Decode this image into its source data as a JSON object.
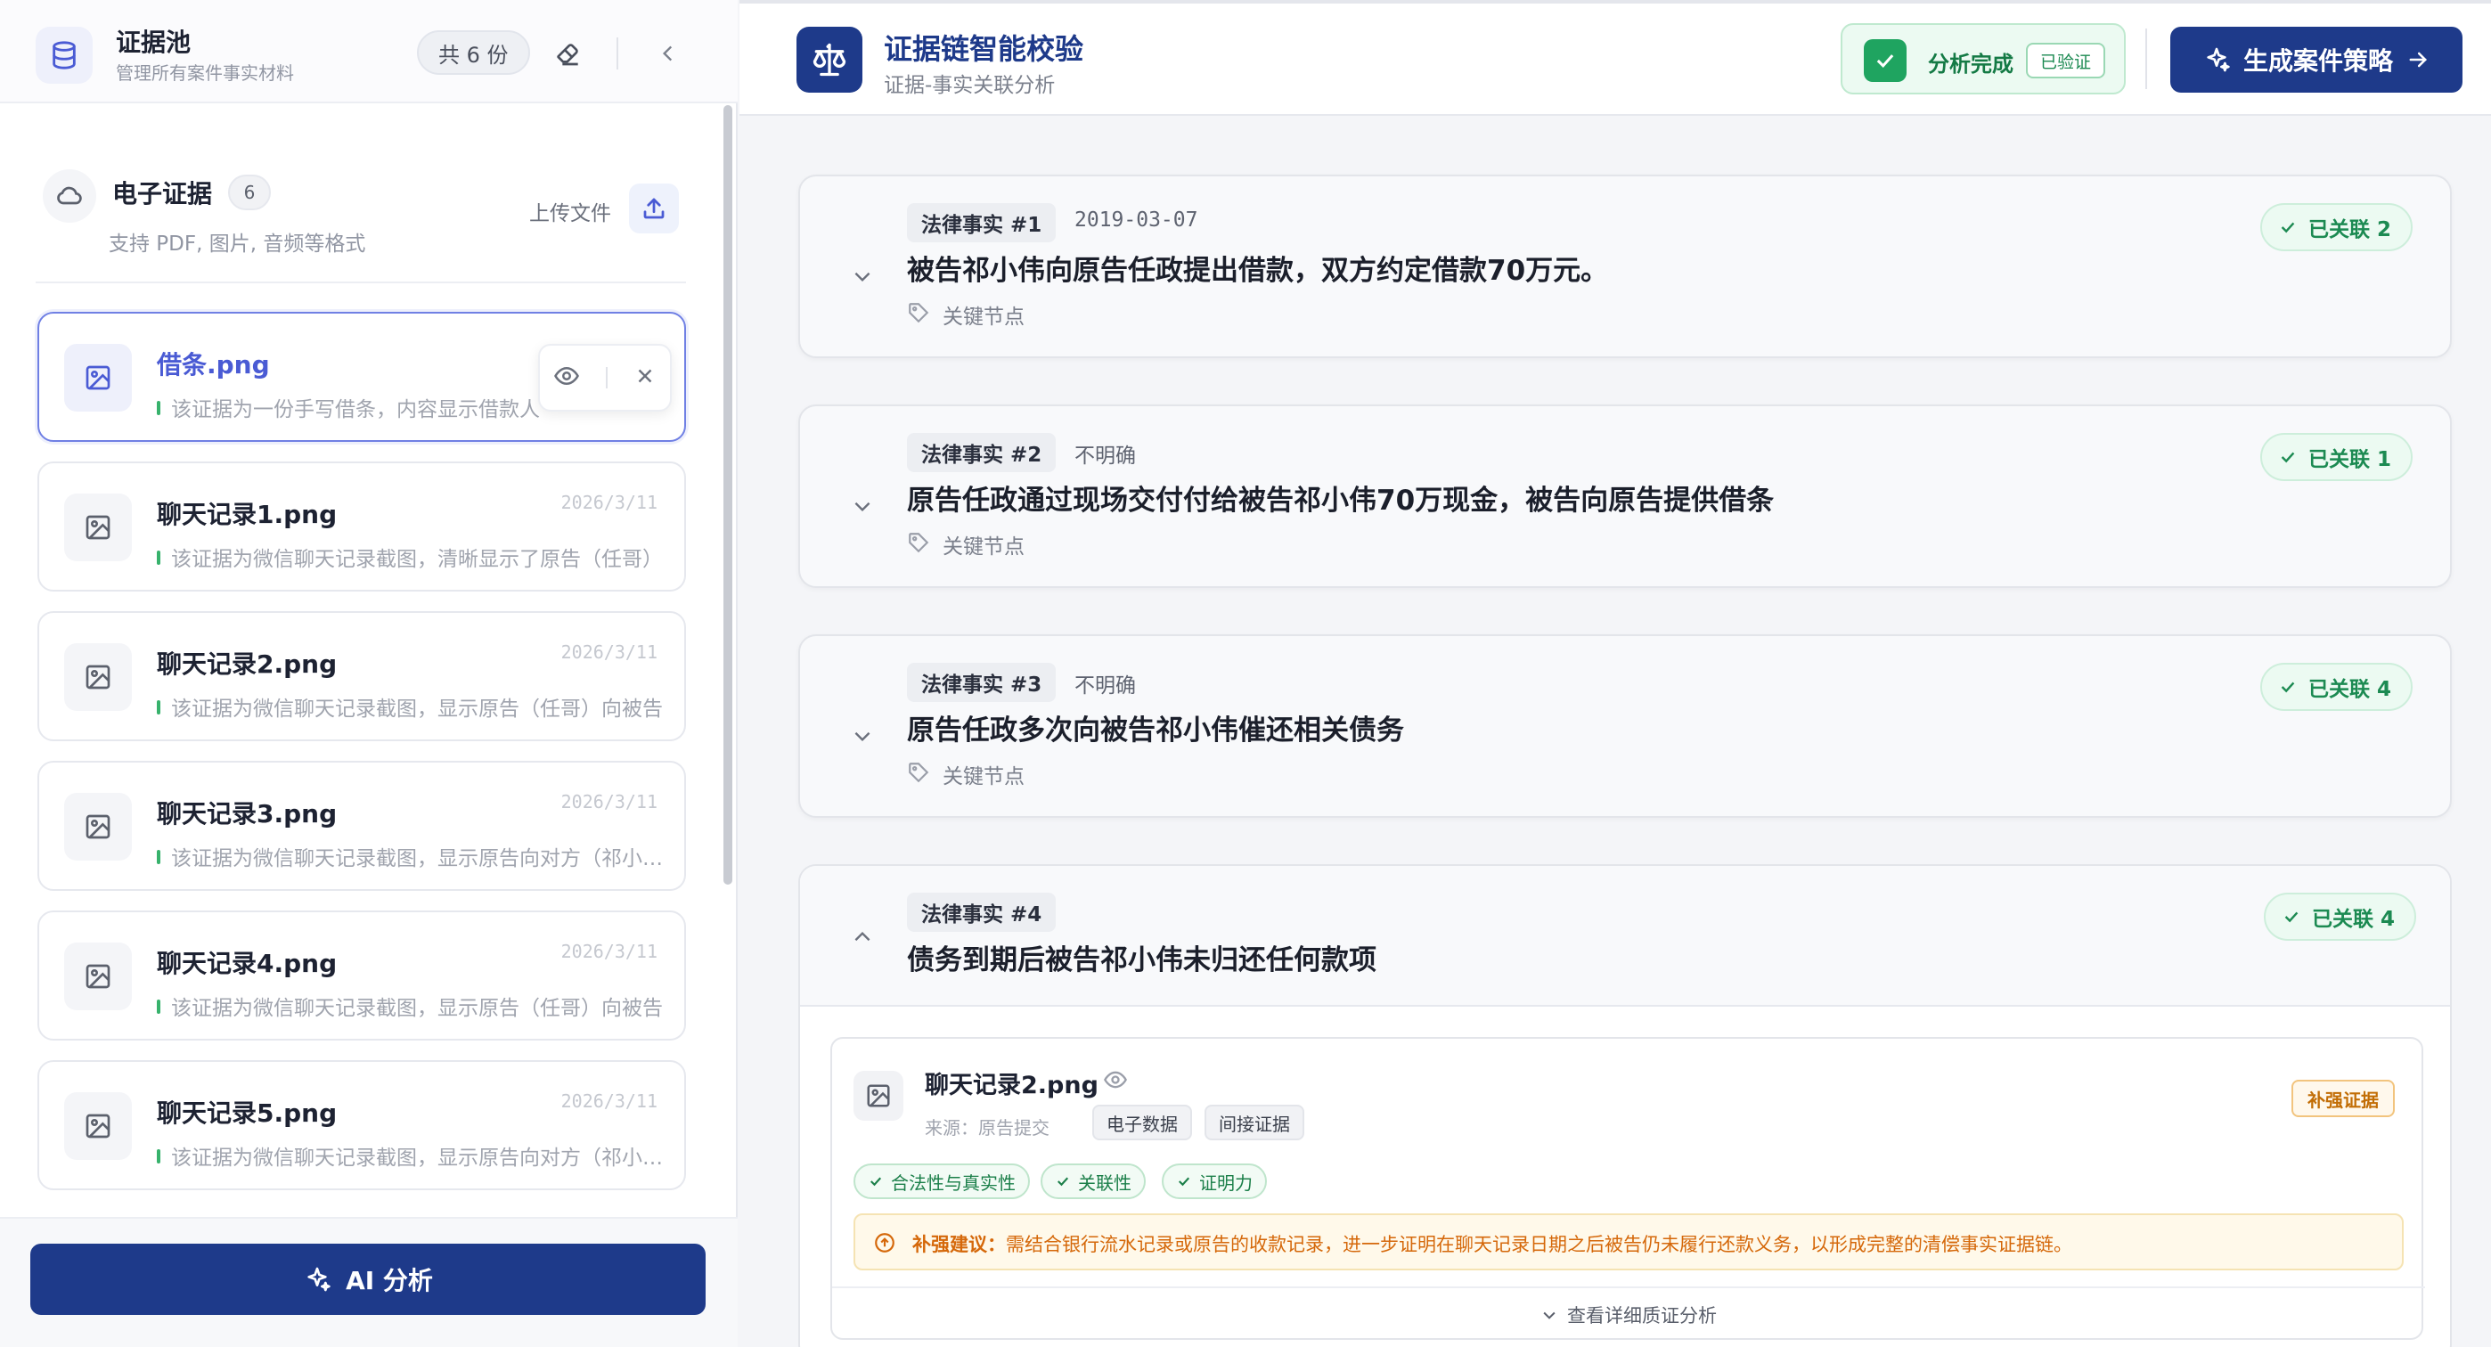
{
  "left_panel": {
    "title": "证据池",
    "subtitle": "管理所有案件事实材料",
    "count_label": "共 6 份",
    "section": {
      "title": "电子证据",
      "count": "6",
      "subtitle": "支持 PDF, 图片, 音频等格式",
      "upload_label": "上传文件"
    },
    "evidence": [
      {
        "name": "借条.png",
        "date": "",
        "desc": "该证据为一份手写借条，内容显示借款人",
        "active": true
      },
      {
        "name": "聊天记录1.png",
        "date": "2026/3/11",
        "desc": "该证据为微信聊天记录截图，清晰显示了原告（任哥）",
        "active": false
      },
      {
        "name": "聊天记录2.png",
        "date": "2026/3/11",
        "desc": "该证据为微信聊天记录截图，显示原告（任哥）向被告",
        "active": false
      },
      {
        "name": "聊天记录3.png",
        "date": "2026/3/11",
        "desc": "该证据为微信聊天记录截图，显示原告向对方（祁小伟）",
        "active": false
      },
      {
        "name": "聊天记录4.png",
        "date": "2026/3/11",
        "desc": "该证据为微信聊天记录截图，显示原告（任哥）向被告",
        "active": false
      },
      {
        "name": "聊天记录5.png",
        "date": "2026/3/11",
        "desc": "该证据为微信聊天记录截图，显示原告向对方（祁小伟）",
        "active": false
      }
    ],
    "ai_button": "AI 分析"
  },
  "header": {
    "title": "证据链智能校验",
    "subtitle": "证据-事实关联分析",
    "status_text": "分析完成",
    "status_tag": "已验证",
    "generate_button": "生成案件策略"
  },
  "facts": [
    {
      "label": "法律事实 #1",
      "date": "2019-03-07",
      "text": "被告祁小伟向原告任政提出借款，双方约定借款70万元。",
      "tag": "关键节点",
      "linked": "已关联 2",
      "expanded": false
    },
    {
      "label": "法律事实 #2",
      "date": "不明确",
      "text": "原告任政通过现场交付付给被告祁小伟70万现金，被告向原告提供借条",
      "tag": "关键节点",
      "linked": "已关联 1",
      "expanded": false
    },
    {
      "label": "法律事实 #3",
      "date": "不明确",
      "text": "原告任政多次向被告祁小伟催还相关债务",
      "tag": "关键节点",
      "linked": "已关联 4",
      "expanded": false
    },
    {
      "label": "法律事实 #4",
      "date": "",
      "text": "债务到期后被告祁小伟未归还任何款项",
      "tag": "",
      "linked": "已关联 4",
      "expanded": true
    }
  ],
  "fact4_evidence": {
    "name": "聊天记录2.png",
    "source": "来源：原告提交",
    "chips": [
      "电子数据",
      "间接证据"
    ],
    "badge": "补强证据",
    "checks": [
      "合法性与真实性",
      "关联性",
      "证明力"
    ],
    "advice_label": "补强建议：",
    "advice_text": "需结合银行流水记录或原告的收款记录，进一步证明在聊天记录日期之后被告仍未履行还款义务，以形成完整的清偿事实证据链。",
    "detail_link": "查看详细质证分析"
  },
  "colors": {
    "brand": "#1e3a8a",
    "accent": "#4a5bd4",
    "success": "#1c8a52",
    "warning": "#c26d05"
  }
}
